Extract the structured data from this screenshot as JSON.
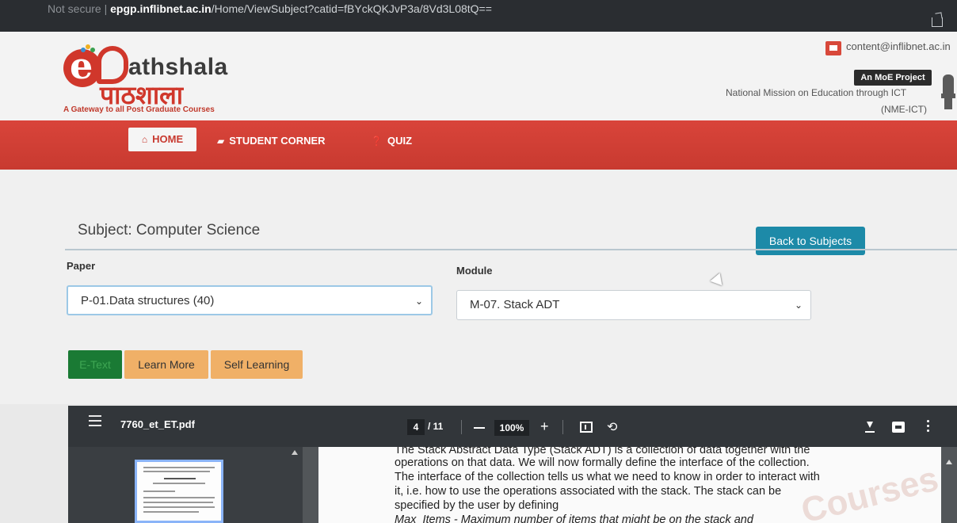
{
  "browser": {
    "not_secure": "Not secure |",
    "domain": "epgp.inflibnet.ac.in",
    "path": "/Home/ViewSubject?catid=fBYckQKJvP3a/8Vd3L08tQ=="
  },
  "header": {
    "logo_text": "athshala",
    "logo_hindi": "पाठशाला",
    "tagline": "A Gateway to all Post Graduate Courses",
    "email": "content@inflibnet.ac.in",
    "badge": "An MoE Project",
    "mission_line1": "National Mission on Education through ICT",
    "mission_line2": "(NME-ICT)"
  },
  "nav": {
    "home": "HOME",
    "student_corner": "STUDENT CORNER",
    "quiz": "QUIZ"
  },
  "subject": {
    "title": "Subject: Computer Science",
    "back_button": "Back to Subjects"
  },
  "filters": {
    "paper_label": "Paper",
    "paper_value": "P-01.Data structures (40)",
    "module_label": "Module",
    "module_value": "M-07. Stack ADT"
  },
  "tabs": {
    "etext": "E-Text",
    "learn_more": "Learn More",
    "self_learning": "Self Learning"
  },
  "pdf": {
    "filename": "7760_et_ET.pdf",
    "page": "4",
    "total": "/ 11",
    "zoom": "100%",
    "lines": [
      "The Stack Abstract Data Type (Stack ADT) is a collection of data together with the",
      "operations on that data. We will now formally define the interface of the collection.",
      "The interface of the collection tells us what we need to know in order to interact with",
      "it, i.e. how to use the operations associated with the stack. The stack can be",
      "specified by the user by defining",
      "Max_Items - Maximum number of items that might be on the stack and"
    ],
    "watermark": "Courses"
  },
  "colors": {
    "nav_red": "#c83a30",
    "teal_button": "#1d8aa8",
    "etext_green": "#1a7a34",
    "tab_orange": "#f0b067",
    "pdf_toolbar": "#32363a"
  }
}
